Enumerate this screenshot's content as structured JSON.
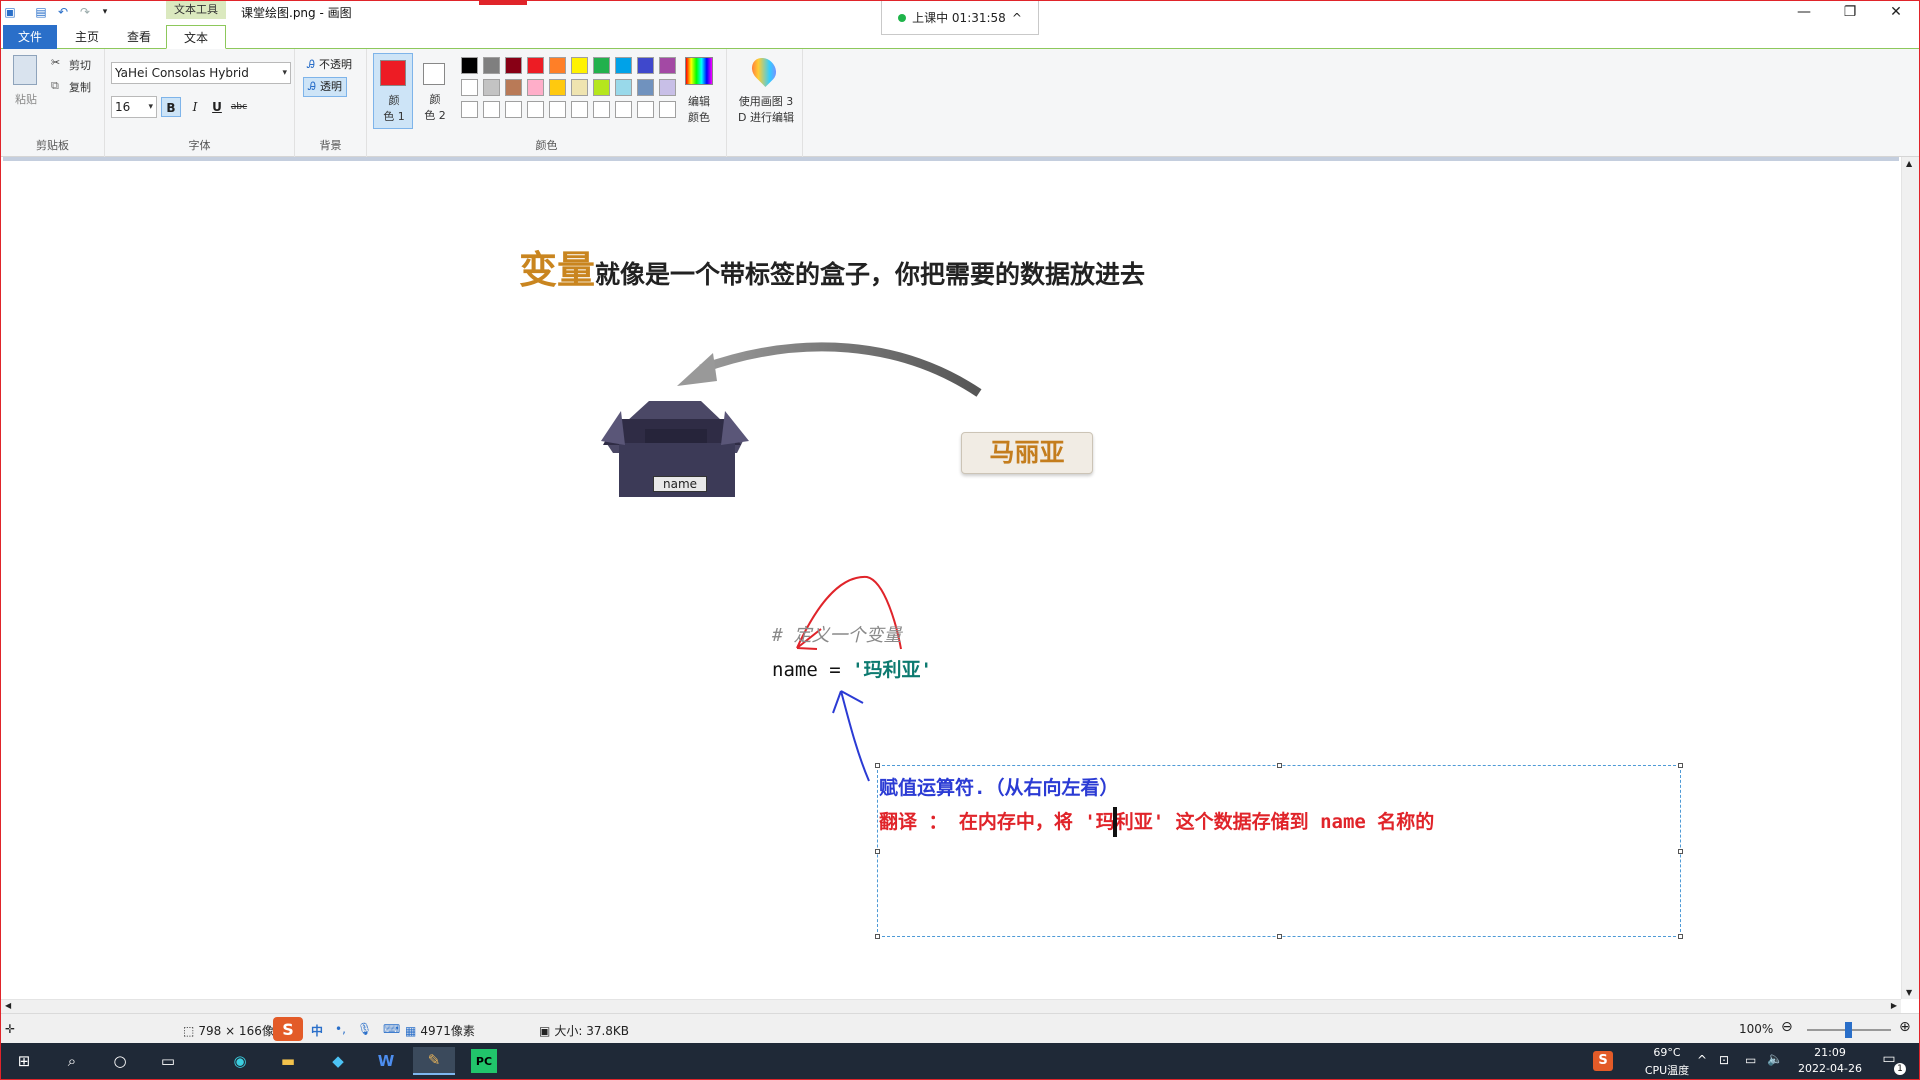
{
  "titlebar": {
    "context_tab": "文本工具",
    "document_title": "课堂绘图.png - 画图",
    "class_timer": "上课中 01:31:58",
    "timer_chevron": "^",
    "minimize": "—",
    "restore": "❐",
    "close": "✕"
  },
  "tabs": [
    "文件",
    "主页",
    "查看",
    "文本"
  ],
  "ribbon": {
    "clipboard": {
      "paste": "粘贴",
      "cut": "剪切",
      "copy": "复制",
      "label": "剪贴板"
    },
    "font": {
      "family": "YaHei Consolas Hybrid",
      "size": "16",
      "bold": "B",
      "italic": "I",
      "underline": "U",
      "strike": "abc",
      "label": "字体"
    },
    "background": {
      "opaque": "不透明",
      "transparent": "透明",
      "label": "背景"
    },
    "colors": {
      "color1": "颜\n色 1",
      "color2": "颜\n色 2",
      "edit": "编辑\n颜色",
      "label": "颜色",
      "color1_value": "#ed1c24",
      "color2_value": "#ffffff",
      "palette": [
        "#000000",
        "#7f7f7f",
        "#880015",
        "#ed1c24",
        "#ff7f27",
        "#fff200",
        "#22b14c",
        "#00a2e8",
        "#3f48cc",
        "#a349a4",
        "#ffffff",
        "#c3c3c3",
        "#b97a57",
        "#ffaec9",
        "#ffc90e",
        "#efe4b0",
        "#b5e61d",
        "#99d9ea",
        "#7092be",
        "#c8bfe7",
        "#ffffff",
        "#ffffff",
        "#ffffff",
        "#ffffff",
        "#ffffff",
        "#ffffff",
        "#ffffff",
        "#ffffff",
        "#ffffff",
        "#ffffff"
      ]
    },
    "paint3d": "使用画图 3\nD 进行编辑"
  },
  "canvas": {
    "heading_accent": "变量",
    "heading_rest": "就像是一个带标签的盒子，你把需要的数据放进去",
    "box_label": "name",
    "tag_card": "马丽亚",
    "code_comment": "# 定义一个变量",
    "code_var": "name = ",
    "code_str": "'玛利亚'",
    "textbox_line1": "赋值运算符.（从右向左看）",
    "textbox_line2": "翻译 ： 在内存中，将 '玛利亚' 这个数据存储到 name 名称的"
  },
  "status": {
    "dimensions": "798 × 166像素",
    "selection": "4971像素",
    "size": "大小: 37.8KB",
    "zoom": "100%",
    "ime": "中",
    "zoom_level": 0.5
  },
  "taskbar": {
    "temp": "69°C",
    "temp_label": "CPU温度",
    "time": "21:09",
    "date": "2022-04-26",
    "notifications": "1"
  }
}
